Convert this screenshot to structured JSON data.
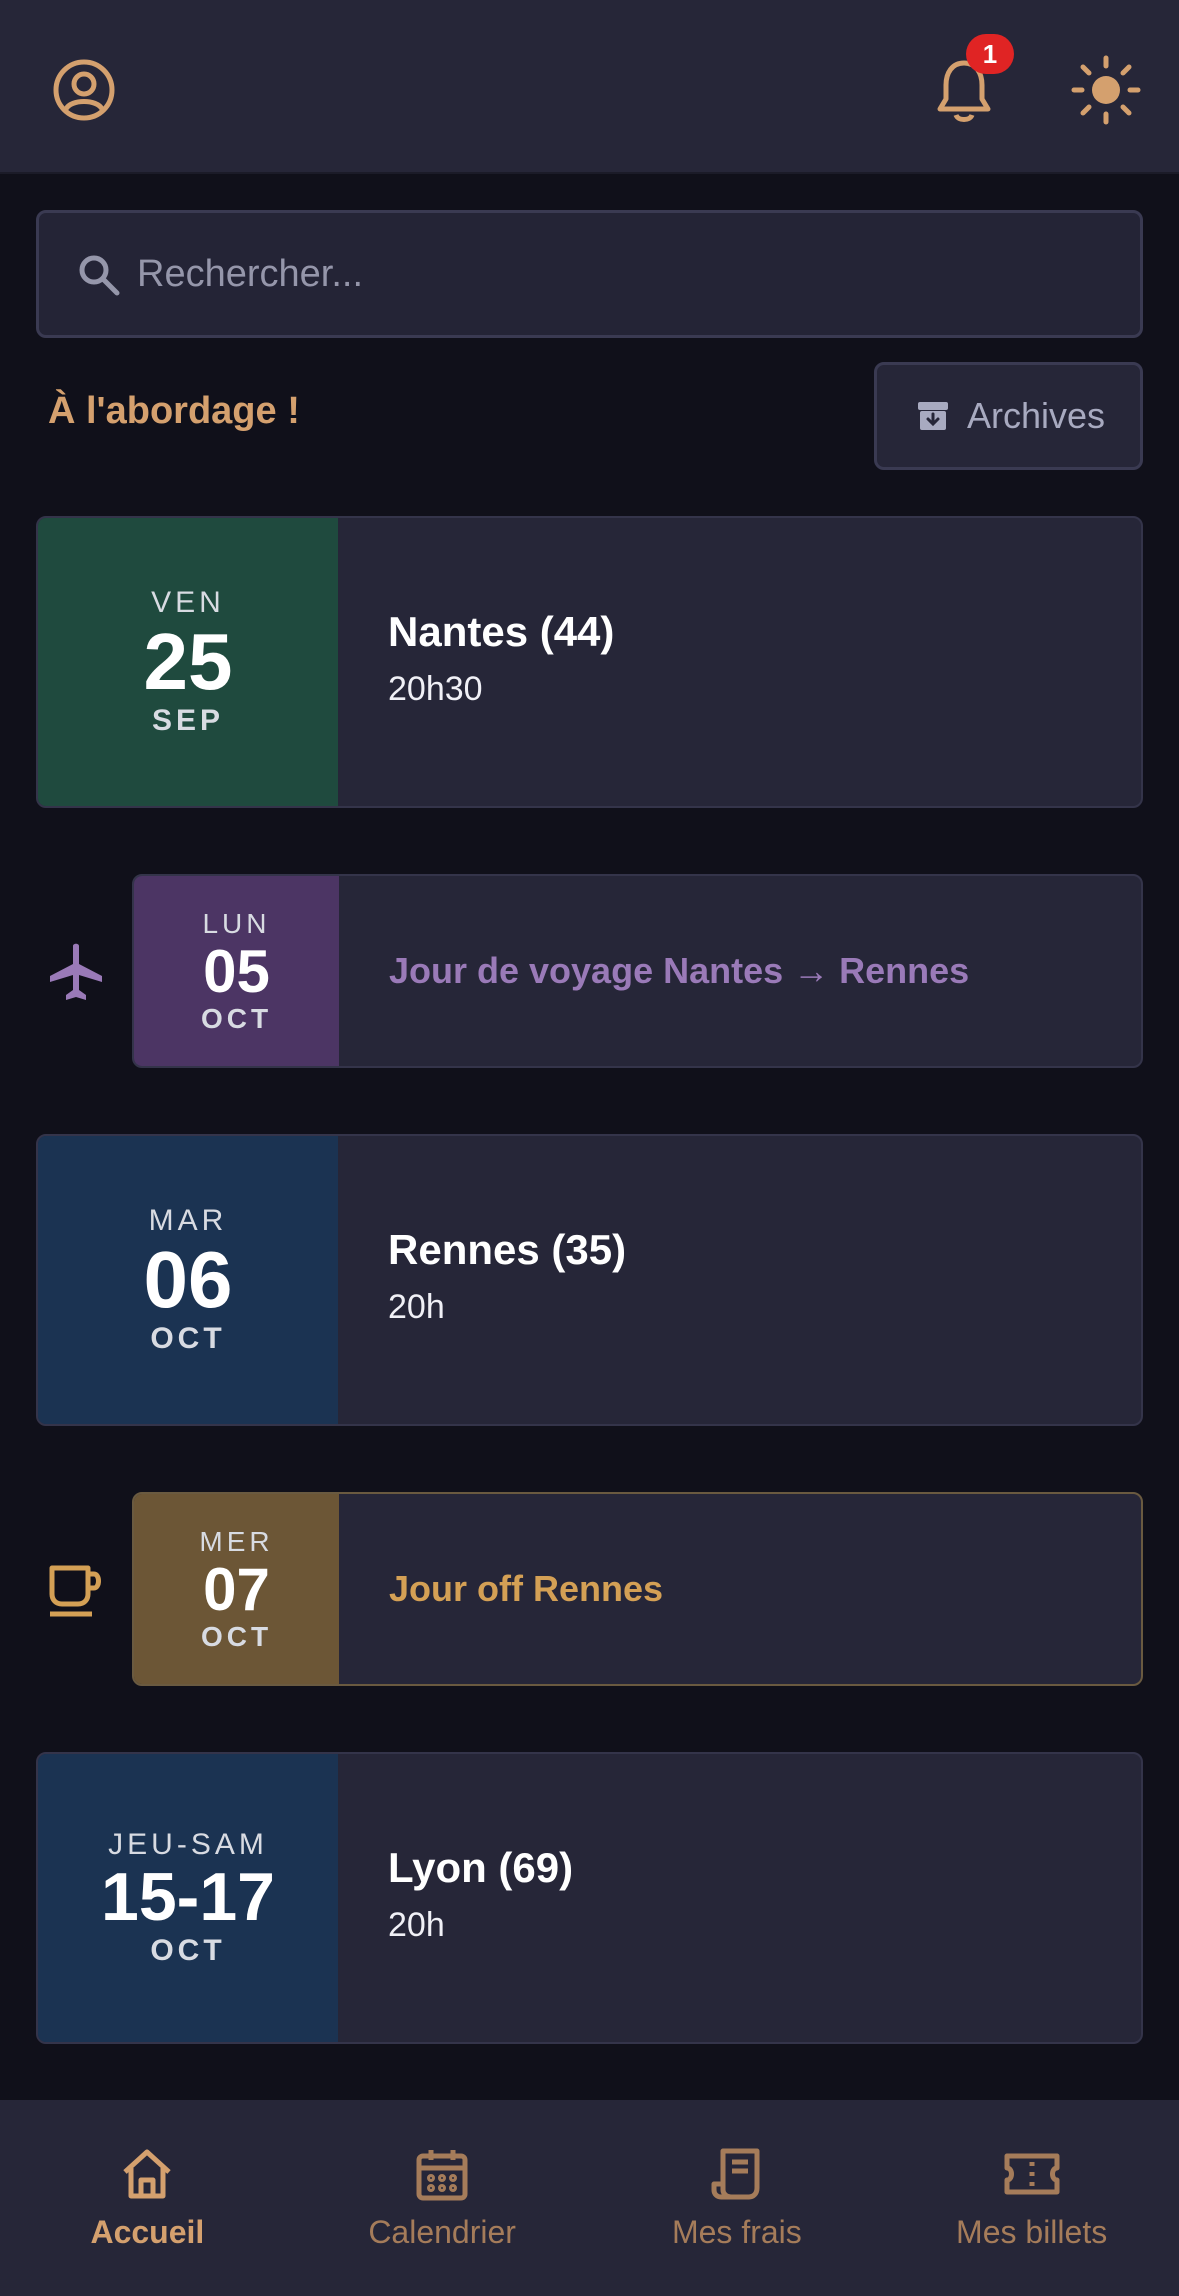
{
  "header": {
    "notification_count": "1",
    "accent_color": "#d4a06e"
  },
  "search": {
    "placeholder": "Rechercher..."
  },
  "section": {
    "title": "À l'abordage !",
    "archives_label": "Archives"
  },
  "events": [
    {
      "type": "concert",
      "day": "VEN",
      "date": "25",
      "month": "SEP",
      "city": "Nantes (44)",
      "time": "20h30",
      "color": "#1f4a3e"
    },
    {
      "type": "travel",
      "day": "LUN",
      "date": "05",
      "month": "OCT",
      "label": "Jour de voyage Nantes → Rennes",
      "color": "#4c3564",
      "icon": "plane-icon"
    },
    {
      "type": "concert",
      "day": "MAR",
      "date": "06",
      "month": "OCT",
      "city": "Rennes (35)",
      "time": "20h",
      "color": "#1b3352"
    },
    {
      "type": "off",
      "day": "MER",
      "date": "07",
      "month": "OCT",
      "label": "Jour off Rennes",
      "color": "#6c5636",
      "icon": "coffee-cup-icon"
    },
    {
      "type": "concert",
      "day": "JEU-SAM",
      "date": "15-17",
      "month": "OCT",
      "city": "Lyon (69)",
      "time": "20h",
      "color": "#1b3352"
    }
  ],
  "nav": [
    {
      "label": "Accueil",
      "icon": "home-icon",
      "active": true
    },
    {
      "label": "Calendrier",
      "icon": "calendar-icon",
      "active": false
    },
    {
      "label": "Mes frais",
      "icon": "receipt-icon",
      "active": false
    },
    {
      "label": "Mes billets",
      "icon": "ticket-icon",
      "active": false
    }
  ]
}
